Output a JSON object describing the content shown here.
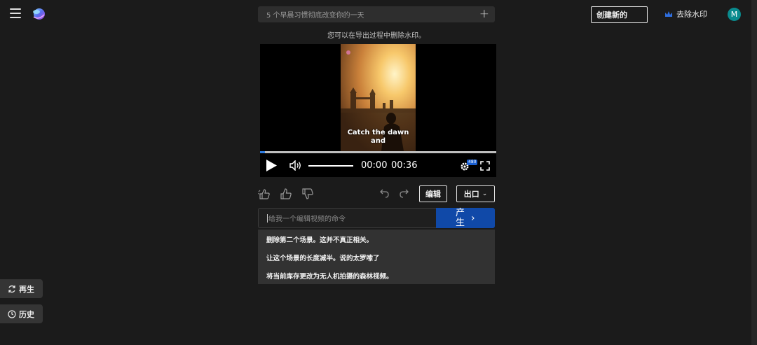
{
  "header": {
    "prompt_text": "5 个早晨习惯彻底改变你的一天",
    "create_new_label": "创建新的",
    "remove_watermark_label": "去除水印",
    "avatar_initial": "M"
  },
  "notice": "您可以在导出过程中删除水印。",
  "player": {
    "caption_line1": "Catch the dawn",
    "caption_line2": "and",
    "current_time": "00:00",
    "duration": "00:36",
    "quality_badge": "480",
    "progress_fraction": 0.02
  },
  "actions": {
    "edit_label": "编辑",
    "export_label": "出口"
  },
  "command": {
    "placeholder": "给我一个编辑视频的命令",
    "generate_label": "产生"
  },
  "suggestions": [
    "删除第二个场景。这并不真正相关。",
    "让这个场景的长度减半。说的太罗嗦了",
    "将当前库存更改为无人机拍摄的森林视频。"
  ],
  "side": {
    "regenerate_label": "再生",
    "history_label": "历史"
  },
  "colors": {
    "accent": "#1049a8",
    "background": "#1b1b1b",
    "avatar": "#0a8b8e"
  }
}
